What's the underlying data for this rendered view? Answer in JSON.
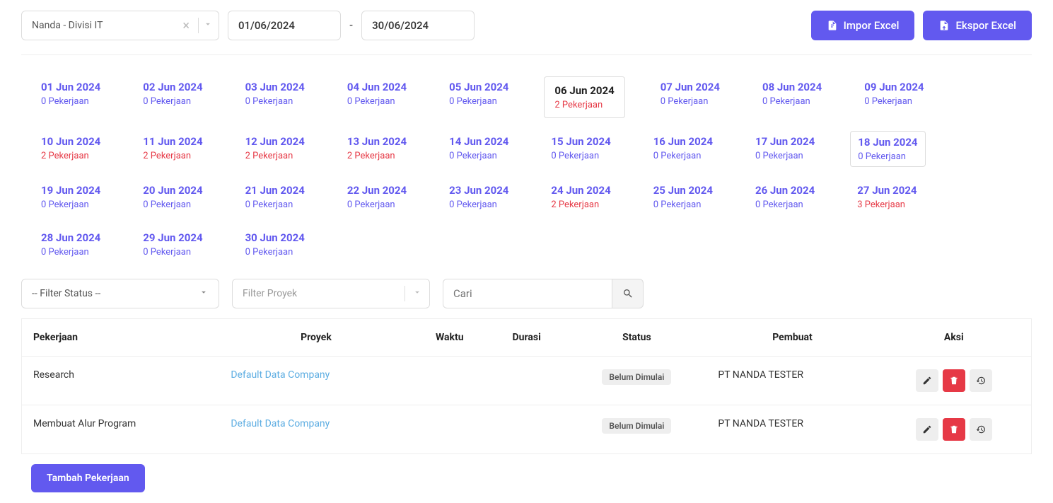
{
  "topbar": {
    "user": "Nanda - Divisi IT",
    "date_from": "01/06/2024",
    "date_to": "30/06/2024",
    "import_label": "Impor Excel",
    "export_label": "Ekspor Excel"
  },
  "selected_index": 5,
  "cal": [
    {
      "date": "01 Jun 2024",
      "count": 0
    },
    {
      "date": "02 Jun 2024",
      "count": 0
    },
    {
      "date": "03 Jun 2024",
      "count": 0
    },
    {
      "date": "04 Jun 2024",
      "count": 0
    },
    {
      "date": "05 Jun 2024",
      "count": 0
    },
    {
      "date": "06 Jun 2024",
      "count": 2
    },
    {
      "date": "07 Jun 2024",
      "count": 0
    },
    {
      "date": "08 Jun 2024",
      "count": 0
    },
    {
      "date": "09 Jun 2024",
      "count": 0
    },
    {
      "date": "10 Jun 2024",
      "count": 2
    },
    {
      "date": "11 Jun 2024",
      "count": 2
    },
    {
      "date": "12 Jun 2024",
      "count": 2
    },
    {
      "date": "13 Jun 2024",
      "count": 2
    },
    {
      "date": "14 Jun 2024",
      "count": 0
    },
    {
      "date": "15 Jun 2024",
      "count": 0
    },
    {
      "date": "16 Jun 2024",
      "count": 0
    },
    {
      "date": "17 Jun 2024",
      "count": 0
    },
    {
      "date": "18 Jun 2024",
      "count": 0
    },
    {
      "date": "19 Jun 2024",
      "count": 0
    },
    {
      "date": "20 Jun 2024",
      "count": 0
    },
    {
      "date": "21 Jun 2024",
      "count": 0
    },
    {
      "date": "22 Jun 2024",
      "count": 0
    },
    {
      "date": "23 Jun 2024",
      "count": 0
    },
    {
      "date": "24 Jun 2024",
      "count": 2
    },
    {
      "date": "25 Jun 2024",
      "count": 0
    },
    {
      "date": "26 Jun 2024",
      "count": 0
    },
    {
      "date": "27 Jun 2024",
      "count": 3
    },
    {
      "date": "28 Jun 2024",
      "count": 0
    },
    {
      "date": "29 Jun 2024",
      "count": 0
    },
    {
      "date": "30 Jun 2024",
      "count": 0
    }
  ],
  "cal_word": "Pekerjaan",
  "filters": {
    "status_placeholder": "-- Filter Status --",
    "project_placeholder": "Filter Proyek",
    "search_placeholder": "Cari"
  },
  "table": {
    "headers": [
      "Pekerjaan",
      "Proyek",
      "Waktu",
      "Durasi",
      "Status",
      "Pembuat",
      "Aksi"
    ],
    "rows": [
      {
        "pekerjaan": "Research",
        "proyek": "Default Data Company",
        "waktu": "",
        "durasi": "",
        "status": "Belum Dimulai",
        "pembuat": "PT NANDA TESTER"
      },
      {
        "pekerjaan": "Membuat Alur Program",
        "proyek": "Default Data Company",
        "waktu": "",
        "durasi": "",
        "status": "Belum Dimulai",
        "pembuat": "PT NANDA TESTER"
      }
    ]
  },
  "add_label": "Tambah Pekerjaan"
}
